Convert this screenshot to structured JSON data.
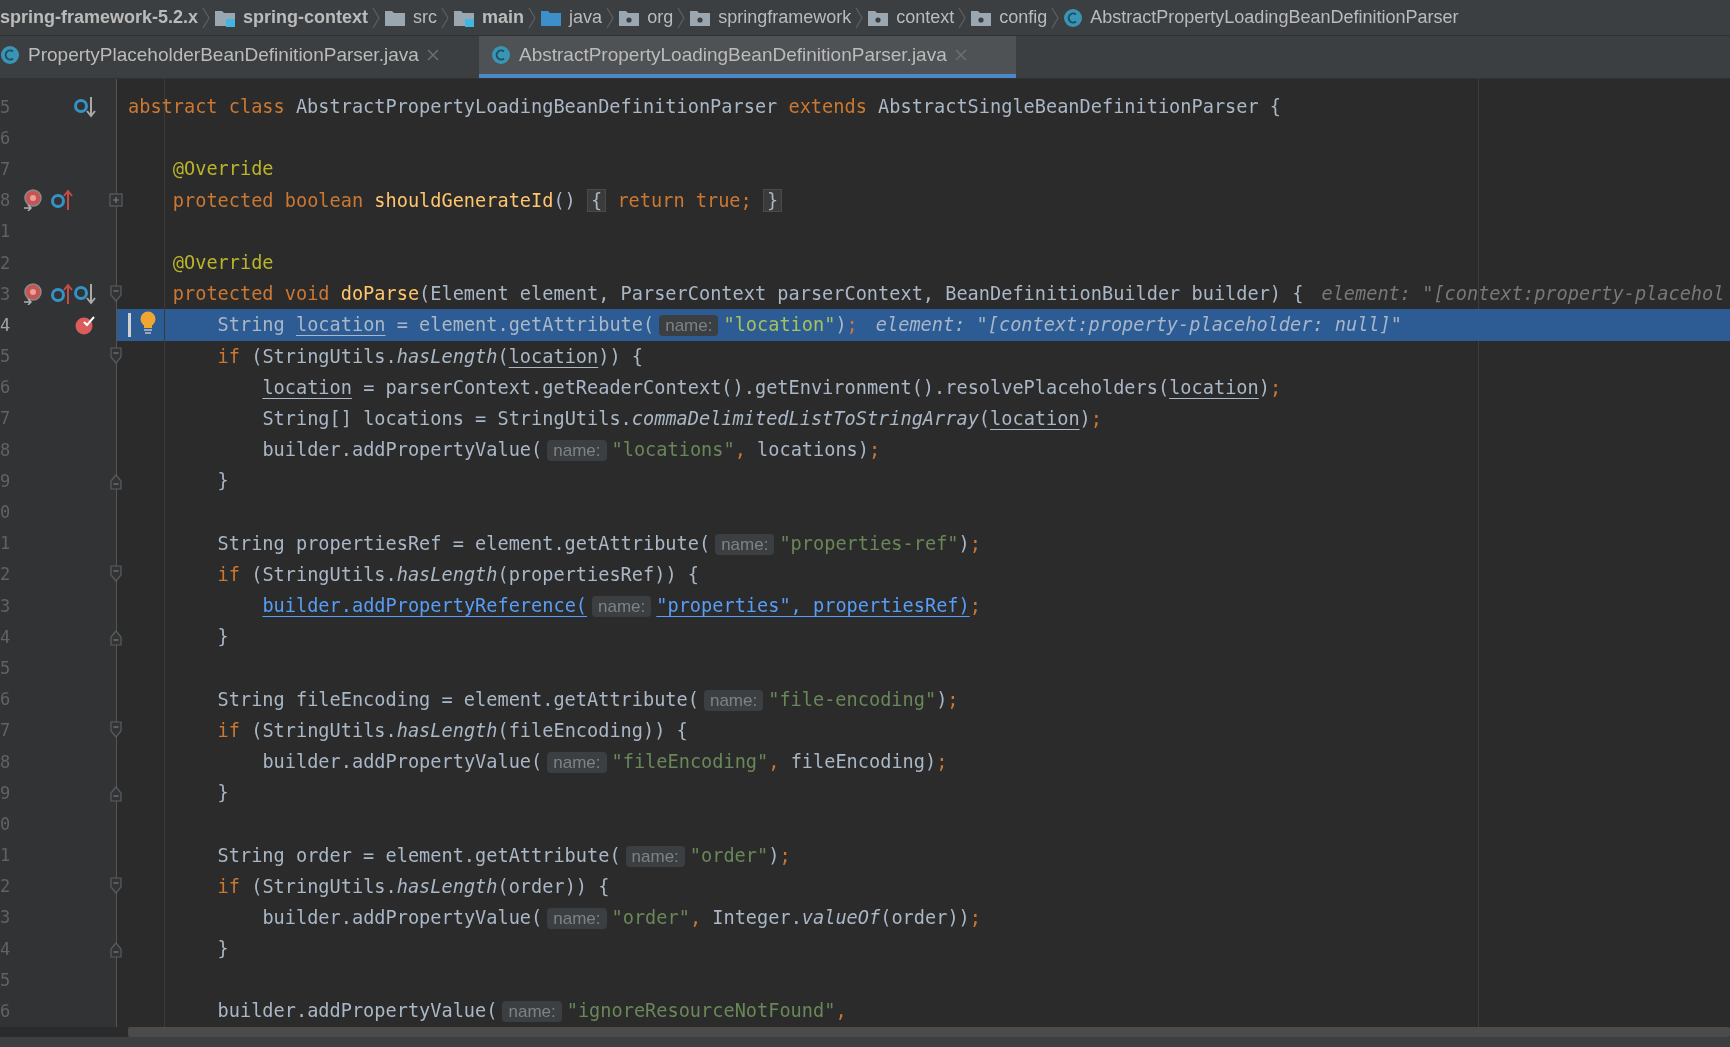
{
  "breadcrumbs": [
    {
      "label": "spring-framework-5.2.x",
      "kind": "project"
    },
    {
      "label": "spring-context",
      "kind": "module"
    },
    {
      "label": "src",
      "kind": "folder"
    },
    {
      "label": "main",
      "kind": "module"
    },
    {
      "label": "java",
      "kind": "source"
    },
    {
      "label": "org",
      "kind": "package"
    },
    {
      "label": "springframework",
      "kind": "package"
    },
    {
      "label": "context",
      "kind": "package"
    },
    {
      "label": "config",
      "kind": "package"
    },
    {
      "label": "AbstractPropertyLoadingBeanDefinitionParser",
      "kind": "class"
    }
  ],
  "tabs": [
    {
      "label": "PropertyPlaceholderBeanDefinitionParser.java",
      "selected": false
    },
    {
      "label": "AbstractPropertyLoadingBeanDefinitionParser.java",
      "selected": true
    }
  ],
  "lines": [
    {
      "line_number": "5",
      "current": false,
      "icons": [
        {
          "kind": "overridden"
        }
      ],
      "tokens": [
        {
          "kind": "kw",
          "text": "abstract class "
        },
        {
          "kind": "plain",
          "text": "AbstractPropertyLoadingBeanDefinitionParser "
        },
        {
          "kind": "kw",
          "text": "extends "
        },
        {
          "kind": "plain",
          "text": "AbstractSingleBeanDefinitionParser {"
        }
      ],
      "children": [
        {
          "line_number": "6",
          "current": false
        },
        {
          "line_number": "7",
          "current": false,
          "tokens": [
            {
              "kind": "ann",
              "text": "@Override"
            }
          ]
        },
        {
          "line_number": "8",
          "current": false,
          "icons": [
            {
              "kind": "method-breakpoint"
            },
            {
              "kind": "overrides"
            }
          ],
          "fold": {
            "kind": "collapsed"
          },
          "tokens": [
            {
              "kind": "kw",
              "text": "protected boolean "
            },
            {
              "kind": "fn",
              "text": "shouldGenerateId"
            },
            {
              "kind": "plain",
              "text": "() "
            },
            {
              "kind": "fold-brace",
              "text": "{"
            },
            {
              "kind": "kw",
              "text": " return true; "
            },
            {
              "kind": "fold-brace",
              "text": "}"
            }
          ]
        },
        {
          "line_number": "1",
          "current": false
        },
        {
          "line_number": "2",
          "current": false,
          "tokens": [
            {
              "kind": "ann",
              "text": "@Override"
            }
          ]
        },
        {
          "line_number": "3",
          "current": false,
          "icons": [
            {
              "kind": "method-breakpoint"
            },
            {
              "kind": "overrides"
            },
            {
              "kind": "overridden"
            }
          ],
          "fold": {
            "kind": "open"
          },
          "tokens": [
            {
              "kind": "kw",
              "text": "protected void "
            },
            {
              "kind": "fn",
              "text": "doParse"
            },
            {
              "kind": "plain",
              "text": "(Element element, ParserContext parserContext, BeanDefinitionBuilder builder) {"
            },
            {
              "kind": "debug",
              "text": "element: \"[context:property-placehol"
            }
          ],
          "children": [
            {
              "line_number": "4",
              "current": true,
              "icons": [
                {
                  "kind": "breakpoint"
                }
              ],
              "tokens": [
                {
                  "kind": "bulb"
                },
                {
                  "kind": "plain",
                  "text": "String "
                },
                {
                  "kind": "ul",
                  "text": "location"
                },
                {
                  "kind": "plain",
                  "text": " = element.getAttribute("
                },
                {
                  "kind": "hint",
                  "text": "name:"
                },
                {
                  "kind": "str",
                  "text": "\"location\""
                },
                {
                  "kind": "plain",
                  "text": ")"
                },
                {
                  "kind": "punct",
                  "text": ";"
                },
                {
                  "kind": "debug",
                  "text": "element: \"[context:property-placeholder: null]\""
                }
              ]
            },
            {
              "line_number": "5",
              "current": false,
              "fold": {
                "kind": "open"
              },
              "tokens": [
                {
                  "kind": "kw",
                  "text": "if "
                },
                {
                  "kind": "plain",
                  "text": "(StringUtils."
                },
                {
                  "kind": "it",
                  "text": "hasLength"
                },
                {
                  "kind": "plain",
                  "text": "("
                },
                {
                  "kind": "ul",
                  "text": "location"
                },
                {
                  "kind": "plain",
                  "text": ")) {"
                }
              ],
              "children": [
                {
                  "line_number": "6",
                  "current": false,
                  "tokens": [
                    {
                      "kind": "ul",
                      "text": "location"
                    },
                    {
                      "kind": "plain",
                      "text": " = parserContext.getReaderContext().getEnvironment().resolvePlaceholders("
                    },
                    {
                      "kind": "ul",
                      "text": "location"
                    },
                    {
                      "kind": "plain",
                      "text": ")"
                    },
                    {
                      "kind": "punct",
                      "text": ";"
                    }
                  ]
                },
                {
                  "line_number": "7",
                  "current": false,
                  "tokens": [
                    {
                      "kind": "plain",
                      "text": "String[] locations = StringUtils."
                    },
                    {
                      "kind": "it",
                      "text": "commaDelimitedListToStringArray"
                    },
                    {
                      "kind": "plain",
                      "text": "("
                    },
                    {
                      "kind": "ul",
                      "text": "location"
                    },
                    {
                      "kind": "plain",
                      "text": ")"
                    },
                    {
                      "kind": "punct",
                      "text": ";"
                    }
                  ]
                },
                {
                  "line_number": "8",
                  "current": false,
                  "tokens": [
                    {
                      "kind": "plain",
                      "text": "builder.addPropertyValue("
                    },
                    {
                      "kind": "hint",
                      "text": "name:"
                    },
                    {
                      "kind": "str",
                      "text": "\"locations\""
                    },
                    {
                      "kind": "punct",
                      "text": ","
                    },
                    {
                      "kind": "plain",
                      "text": " locations)"
                    },
                    {
                      "kind": "punct",
                      "text": ";"
                    }
                  ]
                }
              ]
            },
            {
              "line_number": "9",
              "current": false,
              "fold": {
                "kind": "close"
              },
              "tokens": [
                {
                  "kind": "plain",
                  "text": "}"
                }
              ]
            },
            {
              "line_number": "0",
              "current": false
            },
            {
              "line_number": "1",
              "current": false,
              "tokens": [
                {
                  "kind": "plain",
                  "text": "String propertiesRef = element.getAttribute("
                },
                {
                  "kind": "hint",
                  "text": "name:"
                },
                {
                  "kind": "str",
                  "text": "\"properties-ref\""
                },
                {
                  "kind": "plain",
                  "text": ")"
                },
                {
                  "kind": "punct",
                  "text": ";"
                }
              ]
            },
            {
              "line_number": "2",
              "current": false,
              "fold": {
                "kind": "open"
              },
              "tokens": [
                {
                  "kind": "kw",
                  "text": "if "
                },
                {
                  "kind": "plain",
                  "text": "(StringUtils."
                },
                {
                  "kind": "it",
                  "text": "hasLength"
                },
                {
                  "kind": "plain",
                  "text": "(propertiesRef)) {"
                }
              ],
              "children": [
                {
                  "line_number": "3",
                  "current": false,
                  "tokens": [
                    {
                      "kind": "link",
                      "text": "builder.addPropertyReference("
                    },
                    {
                      "kind": "hint",
                      "text": "name:"
                    },
                    {
                      "kind": "link",
                      "text": "\"properties\", propertiesRef)"
                    },
                    {
                      "kind": "punct",
                      "text": ";"
                    }
                  ]
                }
              ]
            },
            {
              "line_number": "4",
              "current": false,
              "fold": {
                "kind": "close"
              },
              "tokens": [
                {
                  "kind": "plain",
                  "text": "}"
                }
              ]
            },
            {
              "line_number": "5",
              "current": false
            },
            {
              "line_number": "6",
              "current": false,
              "tokens": [
                {
                  "kind": "plain",
                  "text": "String fileEncoding = element.getAttribute("
                },
                {
                  "kind": "hint",
                  "text": "name:"
                },
                {
                  "kind": "str",
                  "text": "\"file-encoding\""
                },
                {
                  "kind": "plain",
                  "text": ")"
                },
                {
                  "kind": "punct",
                  "text": ";"
                }
              ]
            },
            {
              "line_number": "7",
              "current": false,
              "fold": {
                "kind": "open"
              },
              "tokens": [
                {
                  "kind": "kw",
                  "text": "if "
                },
                {
                  "kind": "plain",
                  "text": "(StringUtils."
                },
                {
                  "kind": "it",
                  "text": "hasLength"
                },
                {
                  "kind": "plain",
                  "text": "(fileEncoding)) {"
                }
              ],
              "children": [
                {
                  "line_number": "8",
                  "current": false,
                  "tokens": [
                    {
                      "kind": "plain",
                      "text": "builder.addPropertyValue("
                    },
                    {
                      "kind": "hint",
                      "text": "name:"
                    },
                    {
                      "kind": "str",
                      "text": "\"fileEncoding\""
                    },
                    {
                      "kind": "punct",
                      "text": ","
                    },
                    {
                      "kind": "plain",
                      "text": " fileEncoding)"
                    },
                    {
                      "kind": "punct",
                      "text": ";"
                    }
                  ]
                }
              ]
            },
            {
              "line_number": "9",
              "current": false,
              "fold": {
                "kind": "close"
              },
              "tokens": [
                {
                  "kind": "plain",
                  "text": "}"
                }
              ]
            },
            {
              "line_number": "0",
              "current": false
            },
            {
              "line_number": "1",
              "current": false,
              "tokens": [
                {
                  "kind": "plain",
                  "text": "String order = element.getAttribute("
                },
                {
                  "kind": "hint",
                  "text": "name:"
                },
                {
                  "kind": "str",
                  "text": "\"order\""
                },
                {
                  "kind": "plain",
                  "text": ")"
                },
                {
                  "kind": "punct",
                  "text": ";"
                }
              ]
            },
            {
              "line_number": "2",
              "current": false,
              "fold": {
                "kind": "open"
              },
              "tokens": [
                {
                  "kind": "kw",
                  "text": "if "
                },
                {
                  "kind": "plain",
                  "text": "(StringUtils."
                },
                {
                  "kind": "it",
                  "text": "hasLength"
                },
                {
                  "kind": "plain",
                  "text": "(order)) {"
                }
              ],
              "children": [
                {
                  "line_number": "3",
                  "current": false,
                  "tokens": [
                    {
                      "kind": "plain",
                      "text": "builder.addPropertyValue("
                    },
                    {
                      "kind": "hint",
                      "text": "name:"
                    },
                    {
                      "kind": "str",
                      "text": "\"order\""
                    },
                    {
                      "kind": "punct",
                      "text": ","
                    },
                    {
                      "kind": "plain",
                      "text": " Integer."
                    },
                    {
                      "kind": "it",
                      "text": "valueOf"
                    },
                    {
                      "kind": "plain",
                      "text": "(order))"
                    },
                    {
                      "kind": "punct",
                      "text": ";"
                    }
                  ]
                }
              ]
            },
            {
              "line_number": "4",
              "current": false,
              "fold": {
                "kind": "close"
              },
              "tokens": [
                {
                  "kind": "plain",
                  "text": "}"
                }
              ]
            },
            {
              "line_number": "5",
              "current": false
            },
            {
              "line_number": "6",
              "current": false,
              "tokens": [
                {
                  "kind": "plain",
                  "text": "builder.addPropertyValue("
                },
                {
                  "kind": "hint",
                  "text": "name:"
                },
                {
                  "kind": "str",
                  "text": "\"ignoreResourceNotFound\""
                },
                {
                  "kind": "punct",
                  "text": ","
                }
              ]
            }
          ]
        }
      ]
    }
  ]
}
